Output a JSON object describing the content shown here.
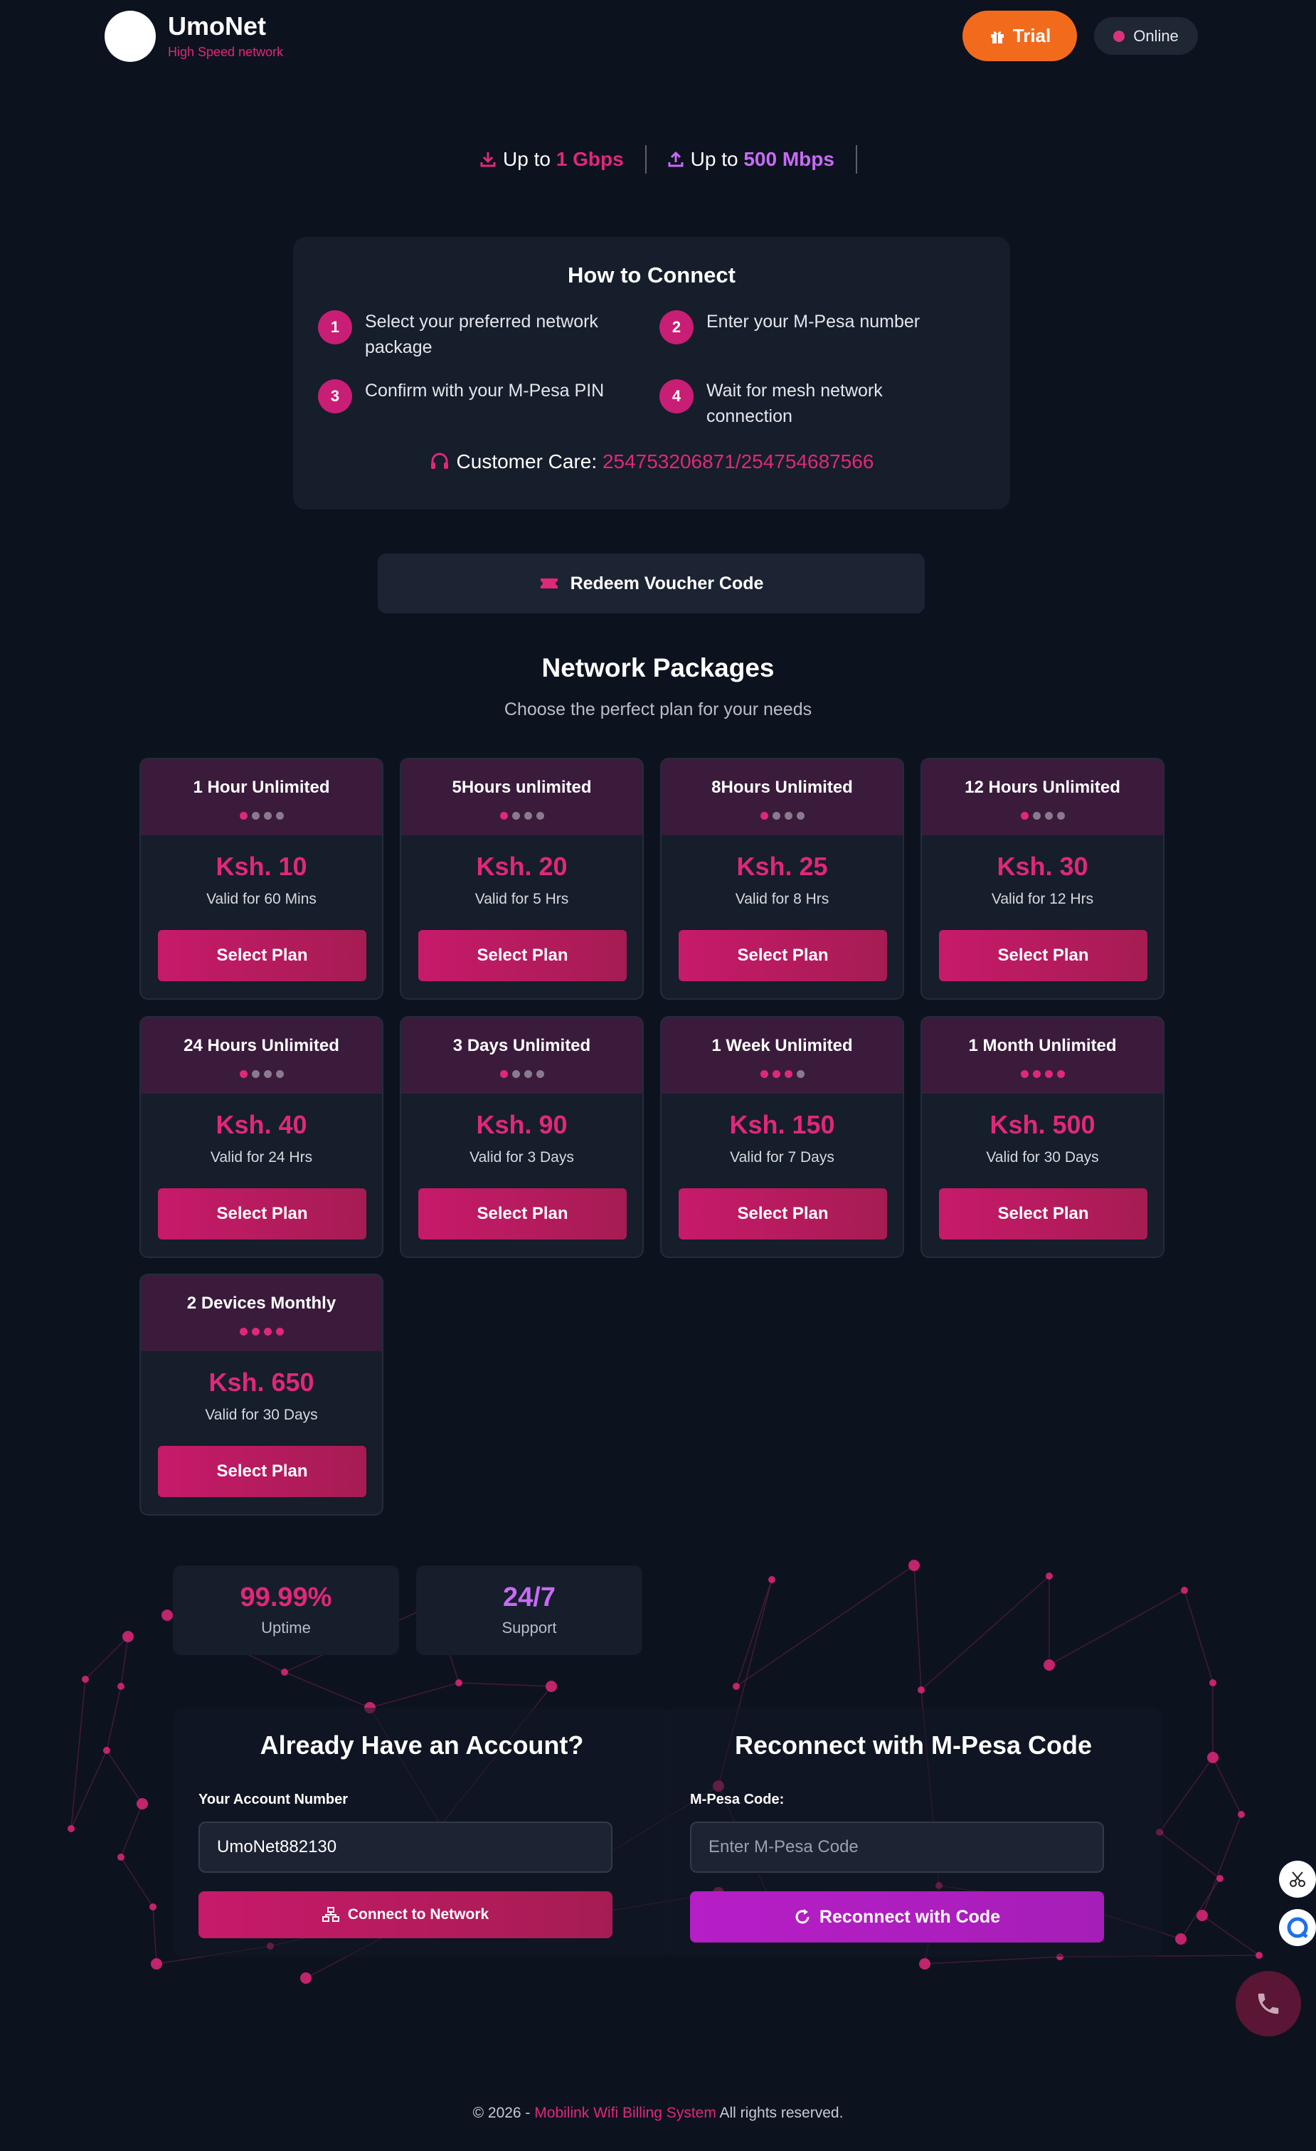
{
  "header": {
    "brand_name": "UmoNet",
    "brand_tagline": "High Speed network",
    "trial_label": "Trial",
    "status_label": "Online"
  },
  "speeds": {
    "download_prefix": "Up to ",
    "download_value": "1 Gbps",
    "upload_prefix": "Up to ",
    "upload_value": "500 Mbps"
  },
  "howto": {
    "title": "How to Connect",
    "steps": [
      {
        "num": "1",
        "text": "Select your preferred network package"
      },
      {
        "num": "2",
        "text": "Enter your M-Pesa number"
      },
      {
        "num": "3",
        "text": "Confirm with your M-Pesa PIN"
      },
      {
        "num": "4",
        "text": "Wait for mesh network connection"
      }
    ],
    "care_label": "Customer Care: ",
    "care_numbers": "254753206871/254754687566"
  },
  "voucher_label": "Redeem Voucher Code",
  "packages": {
    "title": "Network Packages",
    "subtitle": "Choose the perfect plan for your needs",
    "select_label": "Select Plan",
    "plans": [
      {
        "name": "1 Hour Unlimited",
        "price": "Ksh. 10",
        "validity": "Valid for 60 Mins",
        "level": 1
      },
      {
        "name": "5Hours unlimited",
        "price": "Ksh. 20",
        "validity": "Valid for 5 Hrs",
        "level": 1
      },
      {
        "name": "8Hours Unlimited",
        "price": "Ksh. 25",
        "validity": "Valid for 8 Hrs",
        "level": 1
      },
      {
        "name": "12 Hours Unlimited",
        "price": "Ksh. 30",
        "validity": "Valid for 12 Hrs",
        "level": 1
      },
      {
        "name": "24 Hours Unlimited",
        "price": "Ksh. 40",
        "validity": "Valid for 24 Hrs",
        "level": 1
      },
      {
        "name": "3 Days Unlimited",
        "price": "Ksh. 90",
        "validity": "Valid for 3 Days",
        "level": 1
      },
      {
        "name": "1 Week Unlimited",
        "price": "Ksh. 150",
        "validity": "Valid for 7 Days",
        "level": 3
      },
      {
        "name": "1 Month Unlimited",
        "price": "Ksh. 500",
        "validity": "Valid for 30 Days",
        "level": 4
      },
      {
        "name": "2 Devices Monthly",
        "price": "Ksh. 650",
        "validity": "Valid for 30 Days",
        "level": 4
      }
    ]
  },
  "stats": [
    {
      "value": "99.99%",
      "label": "Uptime",
      "color": "#e0287a"
    },
    {
      "value": "24/7",
      "label": "Support",
      "color": "#c76bf5"
    }
  ],
  "account": {
    "title": "Already Have an Account?",
    "field_label": "Your Account Number",
    "field_value": "UmoNet882130",
    "button_label": "Connect to Network"
  },
  "reconnect": {
    "title": "Reconnect with M-Pesa Code",
    "field_label": "M-Pesa Code:",
    "placeholder": "Enter M-Pesa Code",
    "button_label": "Reconnect with Code"
  },
  "footer": {
    "prefix": "© 2026 - ",
    "link": "Mobilink Wifi Billing System",
    "suffix": " All rights reserved."
  },
  "colors": {
    "accent_pink": "#e0287a",
    "accent_purple": "#c76bf5",
    "trial_orange": "#f26b1d",
    "background": "#0d121f"
  },
  "icons": [
    "download-icon",
    "upload-icon",
    "gift-icon",
    "headset-icon",
    "ticket-icon",
    "network-icon",
    "refresh-icon",
    "scissors-icon",
    "chat-icon",
    "phone-icon"
  ]
}
